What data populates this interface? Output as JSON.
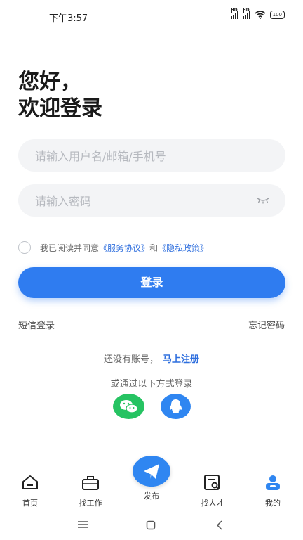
{
  "status_bar": {
    "time": "下午3:57",
    "signal_label": "HD",
    "battery": "100"
  },
  "greeting": {
    "line1": "您好，",
    "line2": "欢迎登录"
  },
  "form": {
    "username_placeholder": "请输入用户名/邮箱/手机号",
    "password_placeholder": "请输入密码"
  },
  "agreement": {
    "prefix": "我已阅读并同意",
    "service": "《服务协议》",
    "and": "和",
    "privacy": "《隐私政策》"
  },
  "login_button": "登录",
  "sms_login": "短信登录",
  "forgot_password": "忘记密码",
  "register": {
    "prompt": "还没有账号，",
    "link": "马上注册"
  },
  "other_login": "或通过以下方式登录",
  "tabs": [
    {
      "label": "首页",
      "icon": "home-icon"
    },
    {
      "label": "找工作",
      "icon": "briefcase-icon"
    },
    {
      "label": "发布",
      "icon": "paper-plane-icon"
    },
    {
      "label": "找人才",
      "icon": "resume-search-icon"
    },
    {
      "label": "我的",
      "icon": "profile-icon"
    }
  ],
  "colors": {
    "accent": "#2f7cf0",
    "link": "#2f6fde",
    "wechat": "#26c362",
    "qq": "#2f86f1"
  }
}
